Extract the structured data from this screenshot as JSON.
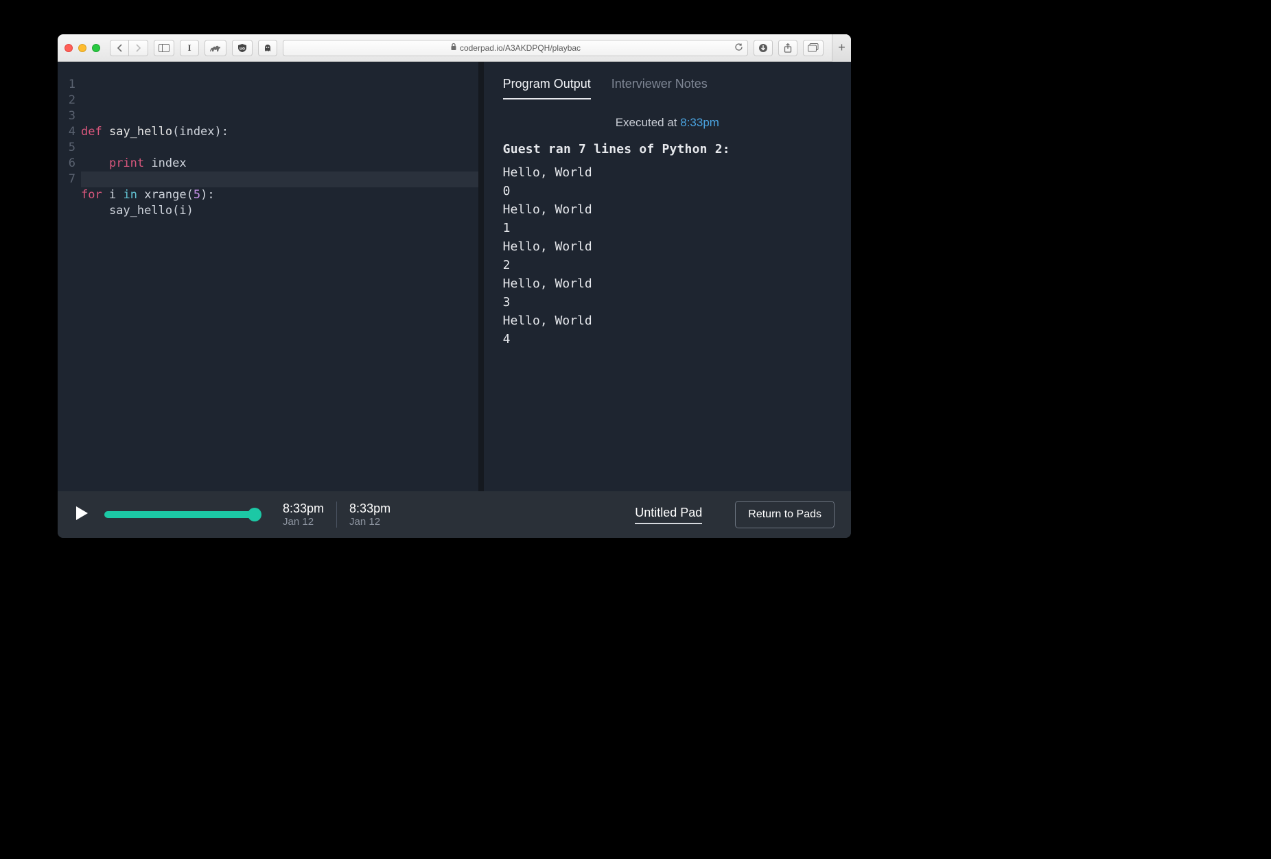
{
  "browser": {
    "url_display": "coderpad.io/A3AKDPQH/playbac"
  },
  "editor": {
    "lines": [
      {
        "n": "1",
        "html": "<span class=\"kw\">def</span> <span class=\"fn\">say_hello</span>(<span class=\"id\">index</span>):"
      },
      {
        "n": "2",
        "html": ""
      },
      {
        "n": "3",
        "html": "    <span class=\"pr\">print</span> <span class=\"id\">index</span>"
      },
      {
        "n": "4",
        "html": ""
      },
      {
        "n": "5",
        "html": "<span class=\"kw\">for</span> <span class=\"id\">i</span> <span class=\"op\">in</span> <span class=\"id\">xrange</span>(<span class=\"num\">5</span>):"
      },
      {
        "n": "6",
        "html": "    <span class=\"id\">say_hello</span>(<span class=\"id\">i</span>)"
      },
      {
        "n": "7",
        "html": ""
      }
    ]
  },
  "output": {
    "tabs": {
      "output": "Program Output",
      "notes": "Interviewer Notes"
    },
    "executed_prefix": "Executed at ",
    "executed_time": "8:33pm",
    "run_header": "Guest ran 7 lines of Python 2:",
    "stdout": "Hello, World\n0\nHello, World\n1\nHello, World\n2\nHello, World\n3\nHello, World\n4"
  },
  "playback": {
    "start": {
      "time": "8:33pm",
      "date": "Jan 12"
    },
    "end": {
      "time": "8:33pm",
      "date": "Jan 12"
    },
    "pad_name": "Untitled Pad",
    "return_label": "Return to Pads"
  }
}
